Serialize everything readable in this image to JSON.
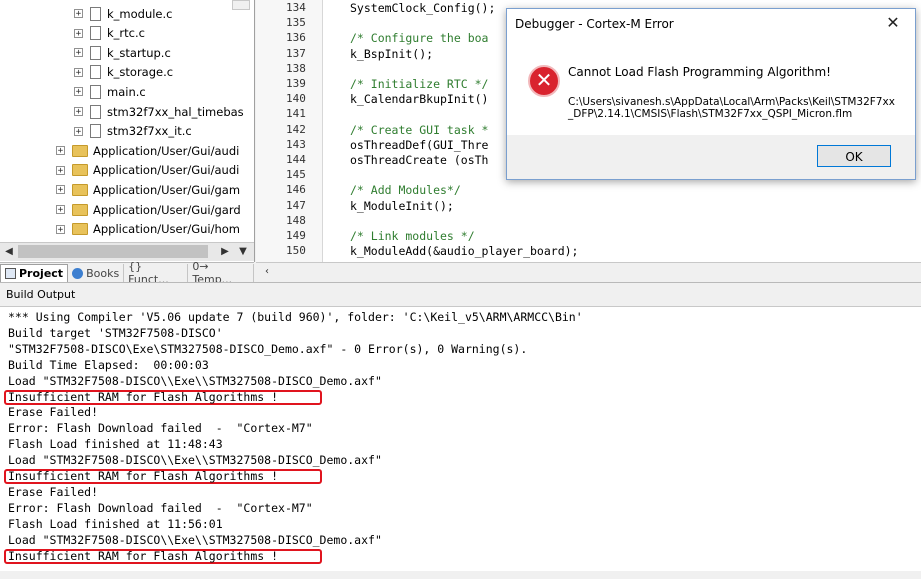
{
  "project_tree": {
    "items": [
      {
        "type": "file",
        "label": "k_module.c"
      },
      {
        "type": "file",
        "label": "k_rtc.c"
      },
      {
        "type": "file",
        "label": "k_startup.c"
      },
      {
        "type": "file",
        "label": "k_storage.c"
      },
      {
        "type": "file",
        "label": "main.c"
      },
      {
        "type": "file",
        "label": "stm32f7xx_hal_timebas"
      },
      {
        "type": "file",
        "label": "stm32f7xx_it.c"
      },
      {
        "type": "folder",
        "label": "Application/User/Gui/audi"
      },
      {
        "type": "folder",
        "label": "Application/User/Gui/audi"
      },
      {
        "type": "folder",
        "label": "Application/User/Gui/gam"
      },
      {
        "type": "folder",
        "label": "Application/User/Gui/gard"
      },
      {
        "type": "folder",
        "label": "Application/User/Gui/hom"
      }
    ],
    "expander_glyph": "+"
  },
  "tabs": [
    {
      "label": "Project",
      "icon": "project-icon"
    },
    {
      "label": "Books",
      "icon": "books-icon"
    },
    {
      "label": "{} Funct...",
      "icon": "functions-icon"
    },
    {
      "label": "0→ Temp...",
      "icon": "templates-icon"
    }
  ],
  "editor": {
    "lines": [
      {
        "num": "134",
        "text": "SystemClock_Config();",
        "kind": "code"
      },
      {
        "num": "135",
        "text": "",
        "kind": "code"
      },
      {
        "num": "136",
        "text": "/* Configure the boa",
        "kind": "comment"
      },
      {
        "num": "137",
        "text": "k_BspInit();",
        "kind": "code"
      },
      {
        "num": "138",
        "text": "",
        "kind": "code"
      },
      {
        "num": "139",
        "text": "/* Initialize RTC */",
        "kind": "comment"
      },
      {
        "num": "140",
        "text": "k_CalendarBkupInit()",
        "kind": "code"
      },
      {
        "num": "141",
        "text": "",
        "kind": "code"
      },
      {
        "num": "142",
        "text": "/* Create GUI task *",
        "kind": "comment"
      },
      {
        "num": "143",
        "text": "osThreadDef(GUI_Thre",
        "kind": "code"
      },
      {
        "num": "144",
        "text": "osThreadCreate (osTh",
        "kind": "code"
      },
      {
        "num": "145",
        "text": "",
        "kind": "code"
      },
      {
        "num": "146",
        "text": "/* Add Modules*/",
        "kind": "comment"
      },
      {
        "num": "147",
        "text": "k_ModuleInit();",
        "kind": "code"
      },
      {
        "num": "148",
        "text": "",
        "kind": "code"
      },
      {
        "num": "149",
        "text": "/* Link modules */",
        "kind": "comment"
      },
      {
        "num": "150",
        "text": "k_ModuleAdd(&audio_player_board);",
        "kind": "code"
      }
    ]
  },
  "dialog": {
    "title": "Debugger - Cortex-M Error",
    "close_glyph": "✕",
    "icon_glyph": "✕",
    "message": "Cannot Load Flash Programming Algorithm!",
    "path": "C:\\Users\\sivanesh.s\\AppData\\Local\\Arm\\Packs\\Keil\\STM32F7xx_DFP\\2.14.1\\CMSIS\\Flash\\STM32F7xx_QSPI_Micron.flm",
    "ok_label": "OK"
  },
  "build_output": {
    "title": "Build Output",
    "lines": [
      "*** Using Compiler 'V5.06 update 7 (build 960)', folder: 'C:\\Keil_v5\\ARM\\ARMCC\\Bin'",
      "Build target 'STM32F7508-DISCO'",
      "\"STM32F7508-DISCO\\Exe\\STM327508-DISCO_Demo.axf\" - 0 Error(s), 0 Warning(s).",
      "Build Time Elapsed:  00:00:03",
      "Load \"STM32F7508-DISCO\\\\Exe\\\\STM327508-DISCO_Demo.axf\"",
      "Insufficient RAM for Flash Algorithms !",
      "Erase Failed!",
      "Error: Flash Download failed  -  \"Cortex-M7\"",
      "Flash Load finished at 11:48:43",
      "Load \"STM32F7508-DISCO\\\\Exe\\\\STM327508-DISCO_Demo.axf\"",
      "Insufficient RAM for Flash Algorithms !",
      "Erase Failed!",
      "Error: Flash Download failed  -  \"Cortex-M7\"",
      "Flash Load finished at 11:56:01",
      "Load \"STM32F7508-DISCO\\\\Exe\\\\STM327508-DISCO_Demo.axf\"",
      "Insufficient RAM for Flash Algorithms !"
    ],
    "highlight_color": "#e0141e"
  }
}
